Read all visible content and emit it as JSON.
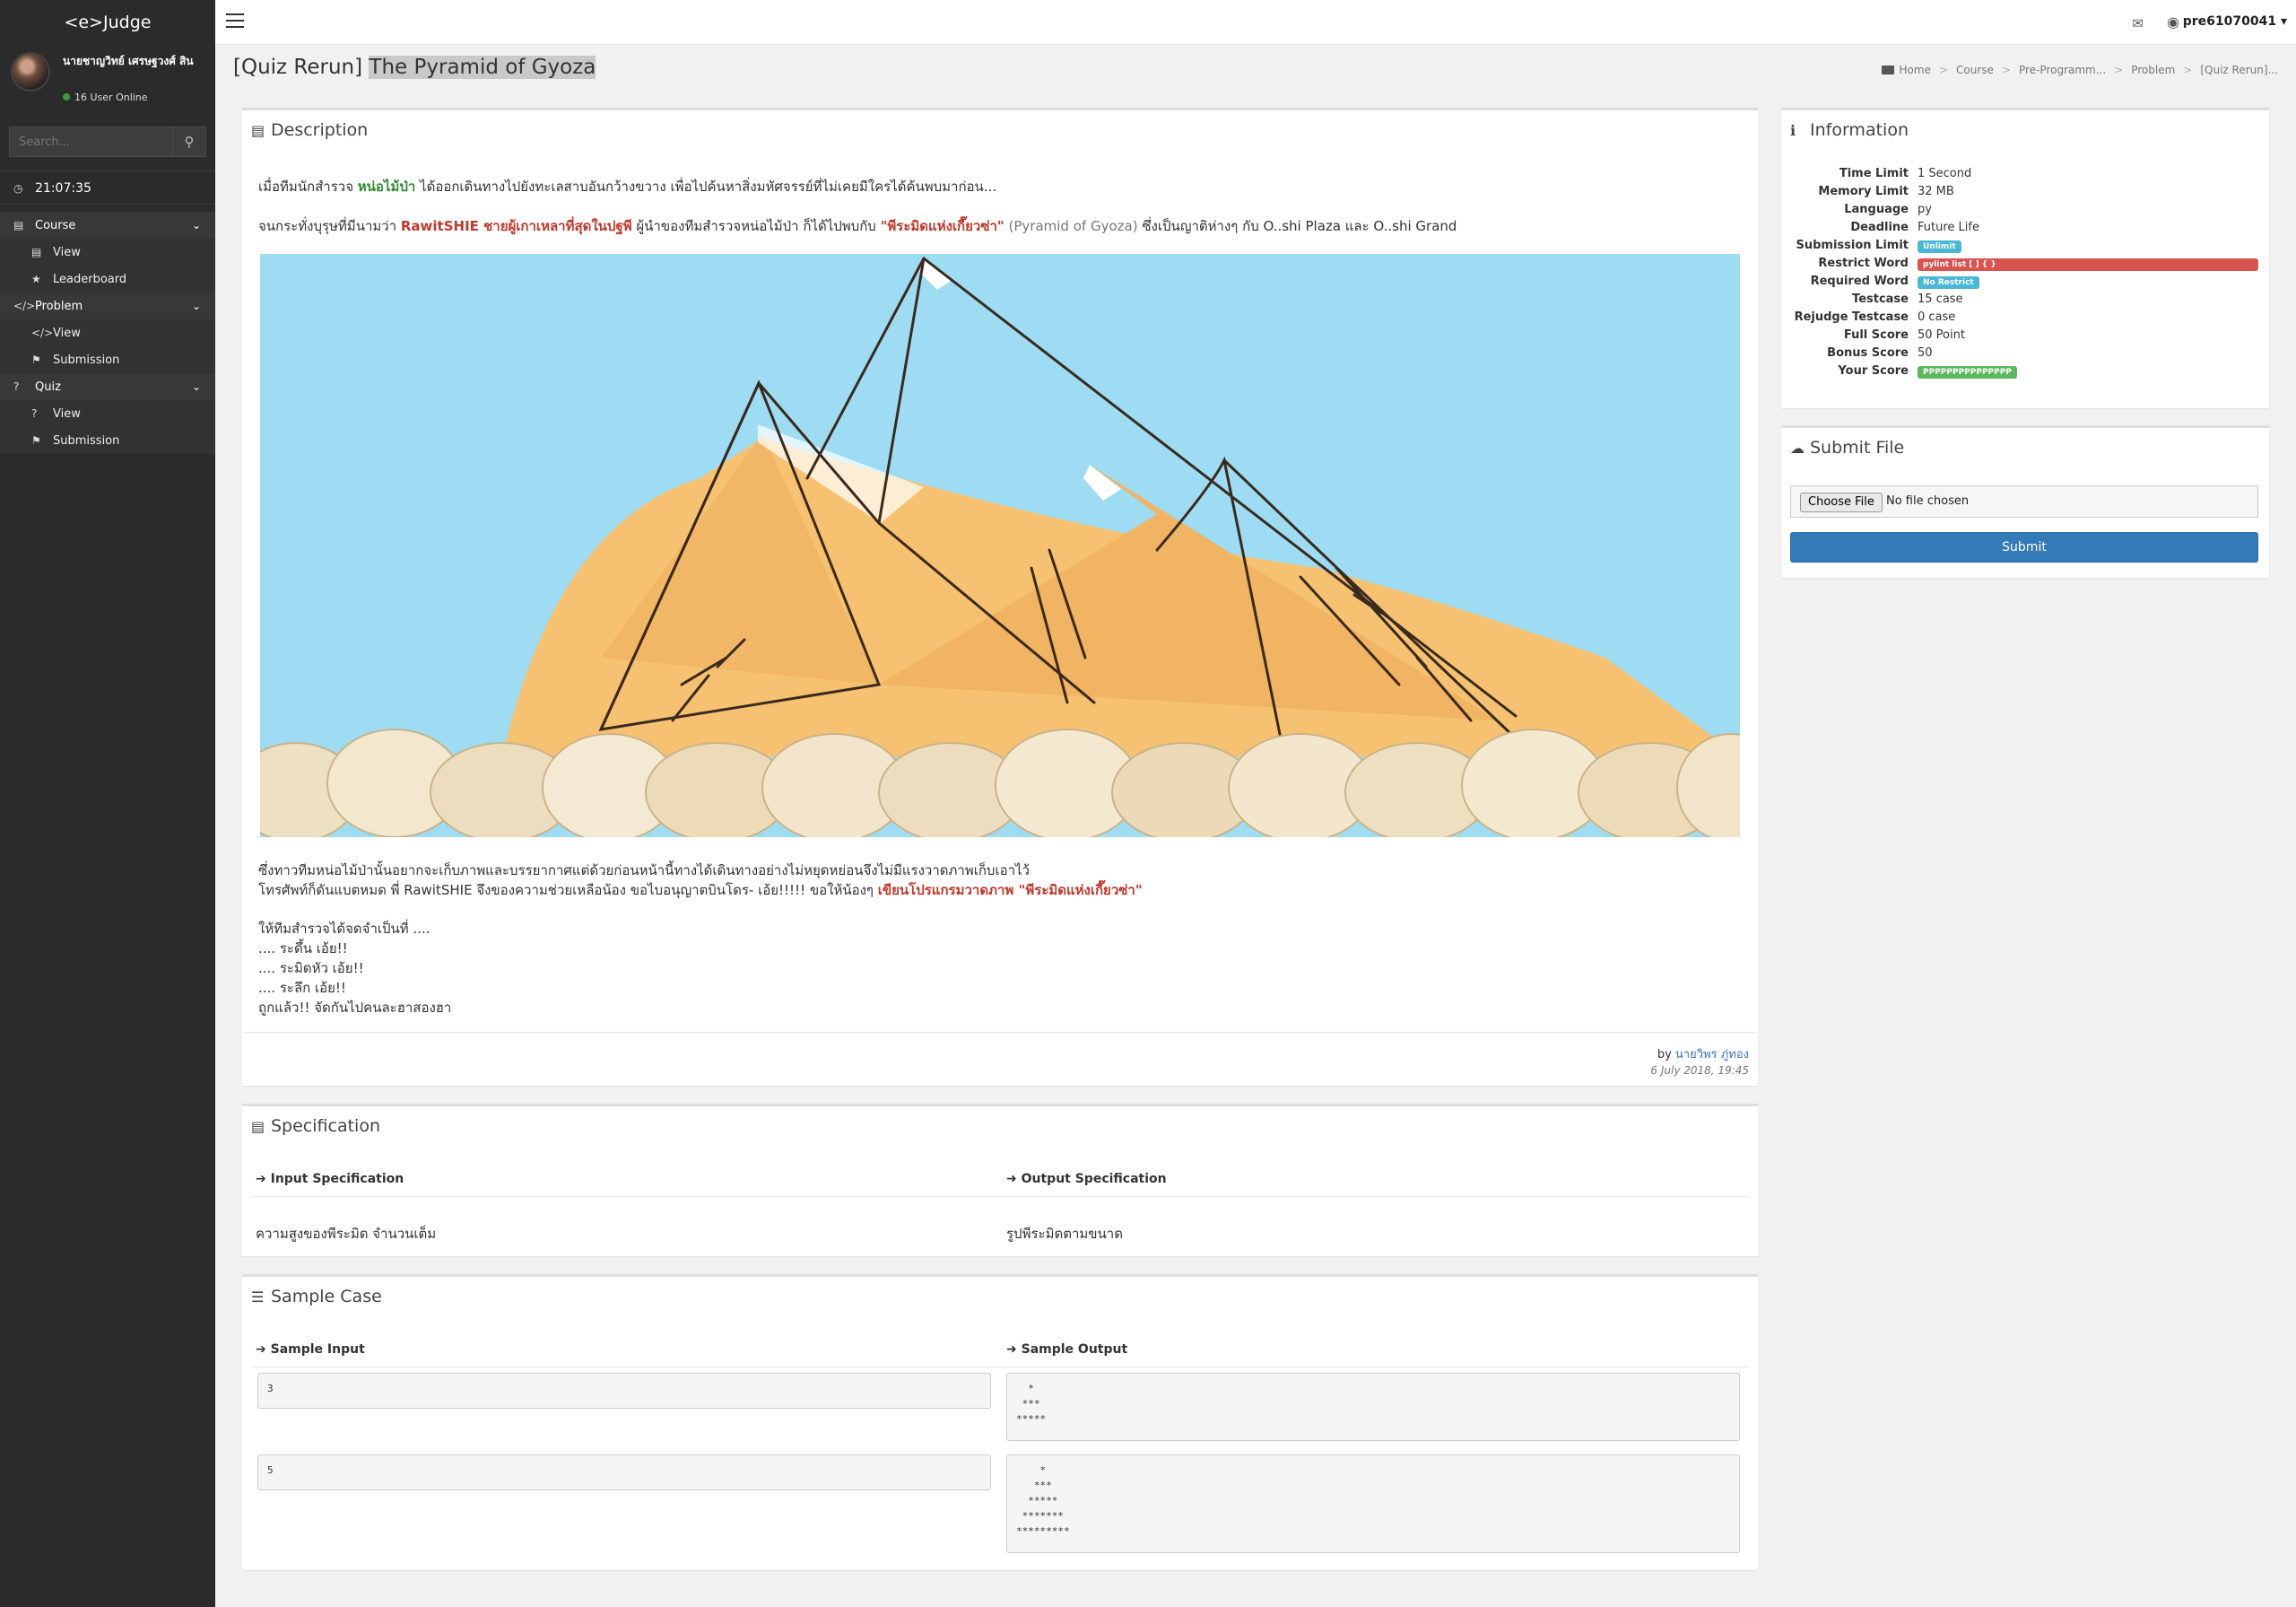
{
  "app": {
    "brand": "<e>Judge"
  },
  "user": {
    "name": "นายชาญวิทย์ เศรษฐวงศ์ สิน",
    "online": "16 User Online"
  },
  "search": {
    "placeholder": "Search..."
  },
  "clock": "21:07:35",
  "menu": {
    "course": {
      "label": "Course",
      "items": [
        "View",
        "Leaderboard"
      ]
    },
    "problem": {
      "label": "Problem",
      "items": [
        "View",
        "Submission"
      ]
    },
    "quiz": {
      "label": "Quiz",
      "items": [
        "View",
        "Submission"
      ]
    }
  },
  "topbar": {
    "username": "pre61070041"
  },
  "page": {
    "title_prefix": "[Quiz Rerun]",
    "title_main": "The Pyramid of Gyoza"
  },
  "breadcrumb": [
    "Home",
    "Course",
    "Pre-Programm...",
    "Problem",
    "[Quiz Rerun]..."
  ],
  "description": {
    "title": "Description",
    "p1_a": "เมื่อทีมนักสำรวจ ",
    "p1_b": "หน่อไม้ป่า",
    "p1_c": " ได้ออกเดินทางไปยังทะเลสาบอันกว้างขวาง เพื่อไปค้นหาสิ่งมหัศจรรย์ที่ไม่เคยมีใครได้ค้นพบมาก่อน...",
    "p2_a": "จนกระทั่งบุรุษที่มีนามว่า ",
    "p2_b": "RawitSHIE ชายผู้เกาเหลาที่สุดในปฐพี",
    "p2_c": " ผู้นำของทีมสำรวจหน่อไม้ป่า ก็ได้ไปพบกับ ",
    "p2_d": "\"พีระมิดแห่งเกี๊ยวซ่า\"",
    "p2_e": " (Pyramid of Gyoza)",
    "p2_f": " ซึ่งเป็นญาติห่างๆ กับ O..shi Plaza และ O..shi Grand",
    "p3": "ซึ่งทาวทีมหน่อไม้ป่านั้นอยากจะเก็บภาพและบรรยากาศแต่ด้วยก่อนหน้านี้ทางได้เดินทางอย่างไม่หยุดหย่อนจึงไม่มีแรงวาดภาพเก็บเอาไว้",
    "p4_a": "โทรศัพท์ก็ดันแบตหมด พี่ RawitSHIE จึงของความช่วยเหลือน้อง ขอไบอนุญาตบินโดร- เอ้ย!!!!! ขอให้น้องๆ ",
    "p4_b": "เขียนโปรแกรมวาดภาพ \"พีระมิดแห่งเกี๊ยวซ่า\"",
    "p5": "ให้ทีมสำรวจได้จดจำเป็นที่ ....",
    "p6": ".... ระดึ้น เอ้ย!!",
    "p7": ".... ระมิดหัว เอ้ย!!",
    "p8": ".... ระลึก เอ้ย!!",
    "p9": "ถูกแล้ว!! จัดกันไปคนละฮาสองฮา",
    "by": "by ",
    "author": "นายวิพร ภู่ทอง",
    "date": "6 July 2018, 19:45"
  },
  "specification": {
    "title": "Specification",
    "input_head": "Input Specification",
    "output_head": "Output Specification",
    "input_text": "ความสูงของพีระมิด จำนวนเต็ม",
    "output_text": "รูปพีระมิดตามขนาด"
  },
  "sample": {
    "title": "Sample Case",
    "input_head": "Sample Input",
    "output_head": "Sample Output",
    "cases": [
      {
        "input": "3",
        "output": "  *\n ***\n*****"
      },
      {
        "input": "5",
        "output": "    *\n   ***\n  *****\n *******\n*********"
      }
    ]
  },
  "info": {
    "title": "Information",
    "rows": [
      {
        "label": "Time Limit",
        "value": "1 Second"
      },
      {
        "label": "Memory Limit",
        "value": "32 MB"
      },
      {
        "label": "Language",
        "value": "py"
      },
      {
        "label": "Deadline",
        "value": "Future Life"
      },
      {
        "label": "Submission Limit",
        "value": "Unlimit"
      },
      {
        "label": "Restrict Word",
        "value": "pylint list [ ] { }"
      },
      {
        "label": "Required Word",
        "value": "No Restrict"
      },
      {
        "label": "Testcase",
        "value": "15 case"
      },
      {
        "label": "Rejudge Testcase",
        "value": "0 case"
      },
      {
        "label": "Full Score",
        "value": "50 Point"
      },
      {
        "label": "Bonus Score",
        "value": "50"
      },
      {
        "label": "Your Score",
        "value": "PPPPPPPPPPPPPPP"
      }
    ],
    "colors": {
      "info_badge": "#4ab7d8",
      "danger_badge": "#d9534f",
      "success_badge": "#5cb85c"
    }
  },
  "submit": {
    "title": "Submit File",
    "choose_label": "Choose File",
    "no_file": "No file chosen",
    "button": "Submit"
  }
}
